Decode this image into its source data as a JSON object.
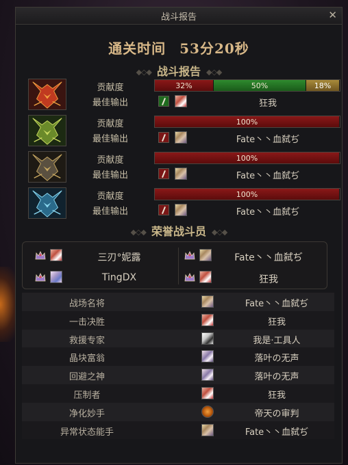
{
  "window": {
    "title": "战斗报告"
  },
  "clear_time": {
    "label": "通关时间",
    "value": "53分20秒"
  },
  "report_section": {
    "heading": "战斗报告"
  },
  "row_labels": {
    "contribution": "贡献度",
    "best_output": "最佳输出"
  },
  "bosses": [
    {
      "icon": "red-horned-boss-icon",
      "segments": [
        {
          "label": "32%",
          "value": 32,
          "color": "red"
        },
        {
          "label": "50%",
          "value": 50,
          "color": "green"
        },
        {
          "label": "18%",
          "value": 18,
          "color": "gold"
        }
      ],
      "best_class_color": "green",
      "best_portrait": "a",
      "best_name": "狂我"
    },
    {
      "icon": "green-horned-boss-icon",
      "segments": [
        {
          "label": "100%",
          "value": 100,
          "color": "red"
        }
      ],
      "best_class_color": "red",
      "best_portrait": "b",
      "best_name": "Fate丶丶血弑ぢ"
    },
    {
      "icon": "dark-gold-boss-icon",
      "segments": [
        {
          "label": "100%",
          "value": 100,
          "color": "red"
        }
      ],
      "best_class_color": "red",
      "best_portrait": "b",
      "best_name": "Fate丶丶血弑ぢ"
    },
    {
      "icon": "blue-horned-boss-icon",
      "segments": [
        {
          "label": "100%",
          "value": 100,
          "color": "red"
        }
      ],
      "best_class_color": "red",
      "best_portrait": "b",
      "best_name": "Fate丶丶血弑ぢ"
    }
  ],
  "honor_section": {
    "heading": "荣誉战斗员"
  },
  "honor_members": [
    {
      "name": "三刃°妮露",
      "portrait": "a"
    },
    {
      "name": "Fate丶丶血弑ぢ",
      "portrait": "b"
    },
    {
      "name": "TingDX",
      "portrait": "f"
    },
    {
      "name": "狂我",
      "portrait": "a"
    }
  ],
  "awards": [
    {
      "title": "战场名将",
      "portrait": "b",
      "winner": "Fate丶丶血弑ぢ"
    },
    {
      "title": "一击决胜",
      "portrait": "a",
      "winner": "狂我"
    },
    {
      "title": "救援专家",
      "portrait": "c",
      "winner": "我是·工具人"
    },
    {
      "title": "晶块富翁",
      "portrait": "d",
      "winner": "落叶の无声"
    },
    {
      "title": "回避之神",
      "portrait": "d",
      "winner": "落叶の无声"
    },
    {
      "title": "压制者",
      "portrait": "a",
      "winner": "狂我"
    },
    {
      "title": "净化妙手",
      "portrait": "e",
      "winner": "帝天の审判"
    },
    {
      "title": "异常状态能手",
      "portrait": "b",
      "winner": "Fate丶丶血弑ぢ"
    }
  ],
  "colors": {
    "accent_gold": "#d8b888",
    "bar_red": "#8a1818",
    "bar_green": "#2e8a2e",
    "bar_gold": "#a88a3a"
  }
}
